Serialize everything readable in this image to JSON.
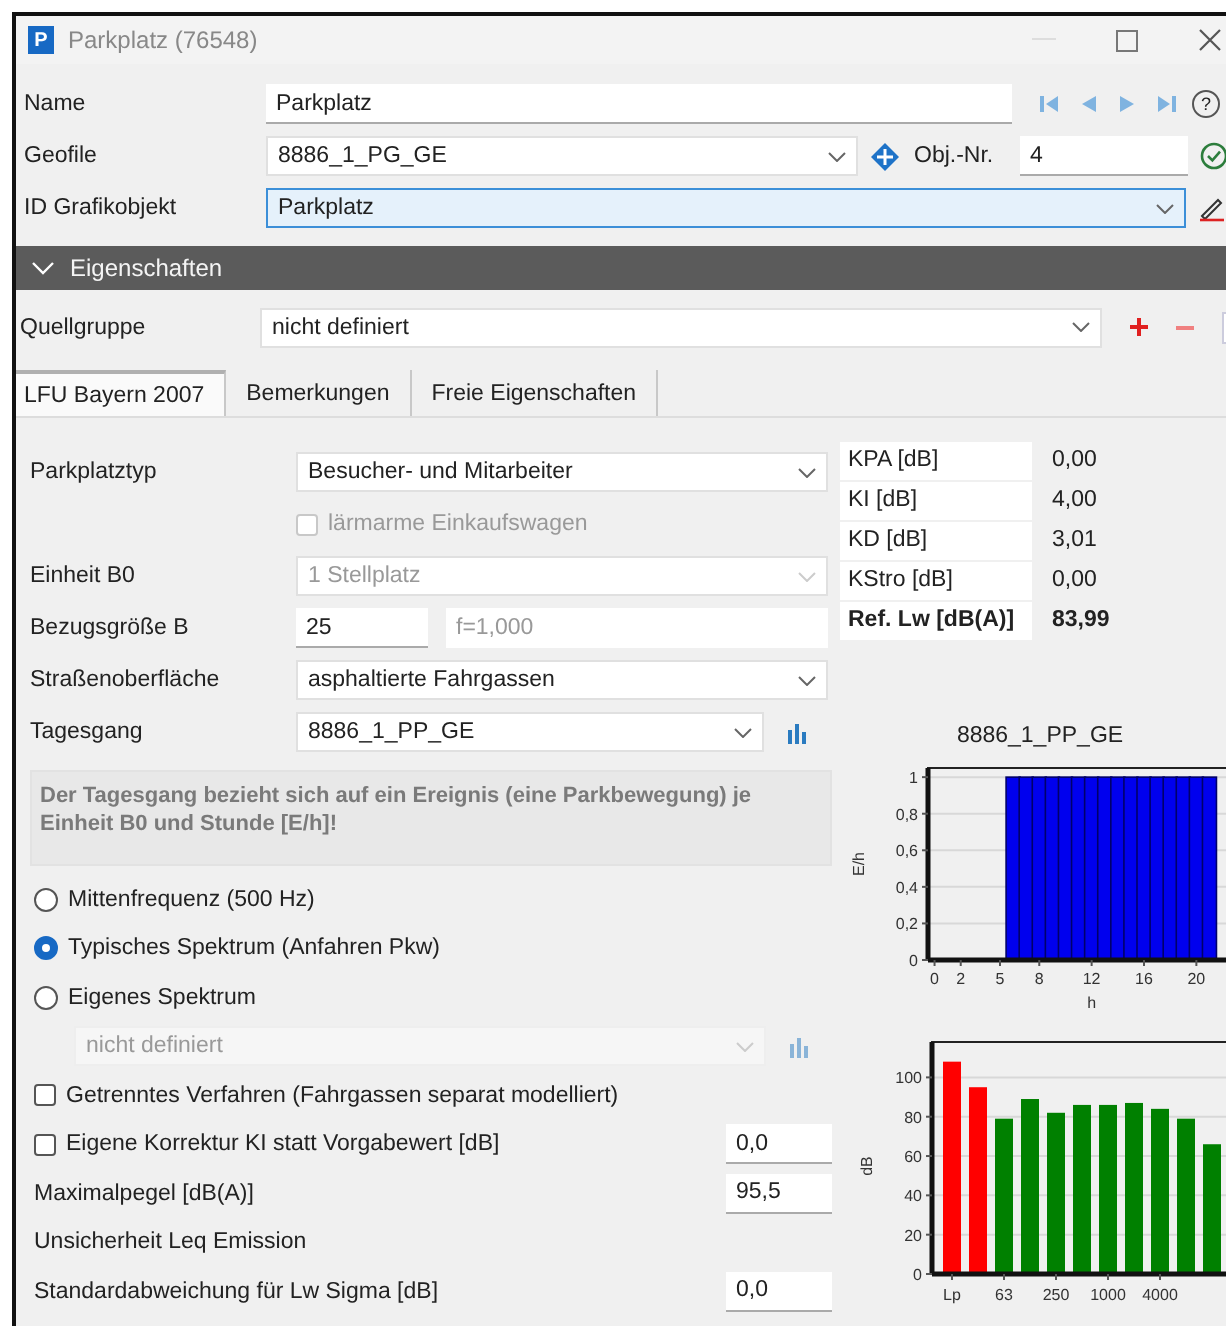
{
  "window": {
    "icon_letter": "P",
    "title": "Parkplatz (76548)"
  },
  "name": {
    "label": "Name",
    "value": "Parkplatz",
    "help": "?"
  },
  "geofile": {
    "label": "Geofile",
    "value": "8886_1_PG_GE",
    "obj_label": "Obj.-Nr.",
    "obj_value": "4"
  },
  "graphic_object": {
    "label": "ID Grafikobjekt",
    "value": "Parkplatz"
  },
  "section": {
    "title": "Eigenschaften",
    "expanded": true
  },
  "source_group": {
    "label": "Quellgruppe",
    "value": "nicht definiert"
  },
  "tabs": [
    {
      "label": "LFU Bayern 2007",
      "selected": true
    },
    {
      "label": "Bemerkungen",
      "selected": false
    },
    {
      "label": "Freie Eigenschaften",
      "selected": false
    }
  ],
  "rows": [
    {
      "kind": "select",
      "label": "Parkplatztyp",
      "value": "Besucher- und Mitarbeiter",
      "disabled": false
    },
    {
      "kind": "sub_checkbox",
      "label": "lärmarme Einkaufswagen",
      "checked": false,
      "disabled": true
    },
    {
      "kind": "select",
      "label": "Einheit B0",
      "value": "1 Stellplatz",
      "disabled": true
    },
    {
      "kind": "pair",
      "label": "Bezugsgröße B",
      "value": "25",
      "factor": "f=1,000"
    },
    {
      "kind": "select",
      "label": "Straßenoberfläche",
      "value": "asphaltierte Fahrgassen",
      "disabled": false
    },
    {
      "kind": "chart_select",
      "label": "Tagesgang",
      "value": "8886_1_PP_GE",
      "disabled": false
    },
    {
      "kind": "note",
      "text": "Der Tagesgang bezieht sich auf ein Ereignis (eine Parkbewegung) je Einheit B0 und Stunde [E/h]!"
    },
    {
      "kind": "radio",
      "label": "Mittenfrequenz (500 Hz)",
      "selected": false
    },
    {
      "kind": "radio",
      "label": "Typisches Spektrum (Anfahren Pkw)",
      "selected": true
    },
    {
      "kind": "radio",
      "label": "Eigenes Spektrum",
      "selected": false
    },
    {
      "kind": "sub_select",
      "value": "nicht definiert",
      "disabled": true
    },
    {
      "kind": "checkbox",
      "label": "Getrenntes Verfahren (Fahrgassen separat modelliert)",
      "checked": false
    },
    {
      "kind": "check_value",
      "label": "Eigene Korrektur KI statt Vorgabewert [dB]",
      "checked": false,
      "value": "0,0"
    },
    {
      "kind": "value",
      "label": "Maximalpegel [dB(A)]",
      "value": "95,5"
    },
    {
      "kind": "heading",
      "label": "Unsicherheit Leq Emission"
    },
    {
      "kind": "value",
      "label": "Standardabweichung für Lw Sigma [dB]",
      "value": "0,0"
    }
  ],
  "factors": [
    {
      "label": "KPA [dB]",
      "value": "0,00",
      "emphasis": false
    },
    {
      "label": "KI [dB]",
      "value": "4,00",
      "emphasis": false
    },
    {
      "label": "KD [dB]",
      "value": "3,01",
      "emphasis": false
    },
    {
      "label": "KStro [dB]",
      "value": "0,00",
      "emphasis": false
    },
    {
      "label": "Ref. Lw  [dB(A)]",
      "value": "83,99",
      "emphasis": true
    }
  ],
  "charts": [
    {
      "chart_data": {
        "type": "bar",
        "title": "8886_1_PP_GE",
        "xlabel": "h",
        "ylabel": "E/h",
        "x": [
          0,
          1,
          2,
          3,
          4,
          5,
          6,
          7,
          8,
          9,
          10,
          11,
          12,
          13,
          14,
          15,
          16,
          17,
          18,
          19,
          20,
          21
        ],
        "series": [
          {
            "color": "#0000ee",
            "values": [
              0,
              0,
              0,
              0,
              0,
              0,
              1,
              1,
              1,
              1,
              1,
              1,
              1,
              1,
              1,
              1,
              1,
              1,
              1,
              1,
              1,
              1
            ]
          }
        ],
        "xlim": [
          -0.5,
          21.5
        ],
        "ylim": [
          0,
          1.05
        ],
        "grid": true,
        "xticks": [
          0,
          2,
          5,
          8,
          12,
          16,
          20
        ],
        "yticks": [
          {
            "value": 0,
            "label": "0"
          },
          {
            "value": 0.2,
            "label": "0,2"
          },
          {
            "value": 0.4,
            "label": "0,4"
          },
          {
            "value": 0.6,
            "label": "0,6"
          },
          {
            "value": 0.8,
            "label": "0,8"
          },
          {
            "value": 1,
            "label": "1"
          }
        ]
      }
    },
    {
      "chart_data": {
        "type": "bar",
        "ylabel": "dB",
        "categories": [
          "Lp",
          null,
          "63",
          null,
          "250",
          null,
          "1000",
          null,
          "4000",
          null,
          null
        ],
        "series": [
          {
            "color": "#ff0000",
            "values": [
              108,
              95,
              null,
              null,
              null,
              null,
              null,
              null,
              null,
              null,
              null
            ]
          },
          {
            "color": "#008000",
            "values": [
              null,
              null,
              79,
              89,
              82,
              86,
              86,
              87,
              84,
              79,
              66
            ]
          }
        ],
        "ylim": [
          0,
          118
        ],
        "grid": true,
        "yticks": [
          {
            "value": 0,
            "label": "0"
          },
          {
            "value": 20,
            "label": "20"
          },
          {
            "value": 40,
            "label": "40"
          },
          {
            "value": 60,
            "label": "60"
          },
          {
            "value": 80,
            "label": "80"
          },
          {
            "value": 100,
            "label": "100"
          }
        ]
      }
    }
  ]
}
